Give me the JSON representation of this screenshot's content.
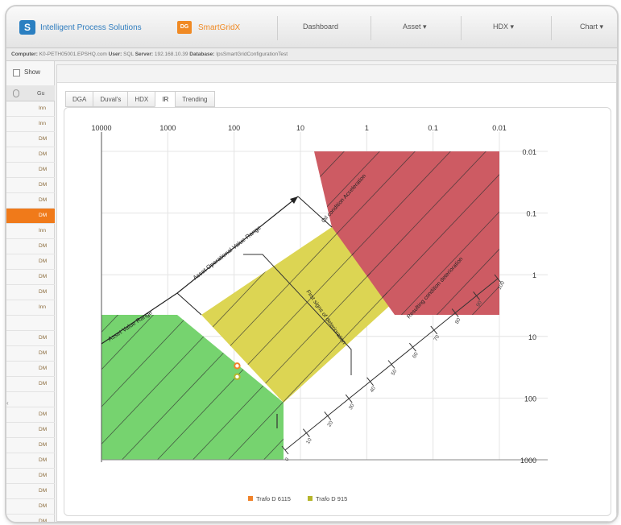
{
  "header": {
    "company_name": "Intelligent Process Solutions",
    "product_badge": "DG",
    "product_name": "SmartGridX",
    "nav": [
      "Dashboard",
      "Asset ▾",
      "HDX ▾",
      "Chart ▾"
    ]
  },
  "infobar": {
    "computer_label": "Computer:",
    "computer_value": "K0-PETH05001.EPSHQ.com",
    "user_label": "User:",
    "user_value": "SQL",
    "server_label": "Server:",
    "server_value": "192.168.10.39",
    "database_label": "Database:",
    "database_value": "IpsSmartGridConfigurationTest"
  },
  "leftgrid": {
    "show_label": "Show",
    "column_label": "Gu",
    "rows": [
      "Inn",
      "Inn",
      "DM",
      "DM",
      "DM",
      "DM",
      "DM",
      "DM",
      "Inn",
      "DM",
      "DM",
      "DM",
      "DM",
      "Inn",
      "",
      "DM",
      "DM",
      "DM",
      "DM",
      "",
      "DM",
      "DM",
      "DM",
      "DM",
      "DM",
      "DM",
      "DM",
      "DM"
    ],
    "active_row": 7
  },
  "tabs": [
    "DGA",
    "Duval's",
    "HDX",
    "IR",
    "Trending"
  ],
  "active_tab": 3,
  "chart_data": {
    "type": "scatter",
    "x_axis": {
      "scale": "log",
      "reversed": true,
      "ticks": [
        "10000",
        "1000",
        "100",
        "10",
        "1",
        "0.1",
        "0.01"
      ]
    },
    "y_axis": {
      "scale": "log",
      "reversed": true,
      "ticks": [
        "0.01",
        "0.1",
        "1",
        "10",
        "100",
        "1000"
      ]
    },
    "regions": [
      {
        "label": "Asset Value Range",
        "color": "#6fcf6f"
      },
      {
        "label": "Asset Operational Value Range",
        "color": "#dcd34f"
      },
      {
        "label": "Oil condition Acceleration",
        "color": "#c85a5e"
      }
    ],
    "annotations": [
      "First signs of deterioration",
      "Resulting condition deterioration"
    ],
    "diagonal_scale_ticks": [
      "0",
      "10",
      "20",
      "30",
      "40",
      "50",
      "60",
      "70",
      "80",
      "90",
      "100"
    ],
    "grid": true,
    "legend_position": "bottom",
    "series": [
      {
        "name": "Trafo D 6115",
        "color": "#f0822a",
        "x": 90,
        "y": 30
      },
      {
        "name": "Trafo D 915",
        "color": "#b5b52a",
        "x": 90,
        "y": 45
      }
    ]
  }
}
